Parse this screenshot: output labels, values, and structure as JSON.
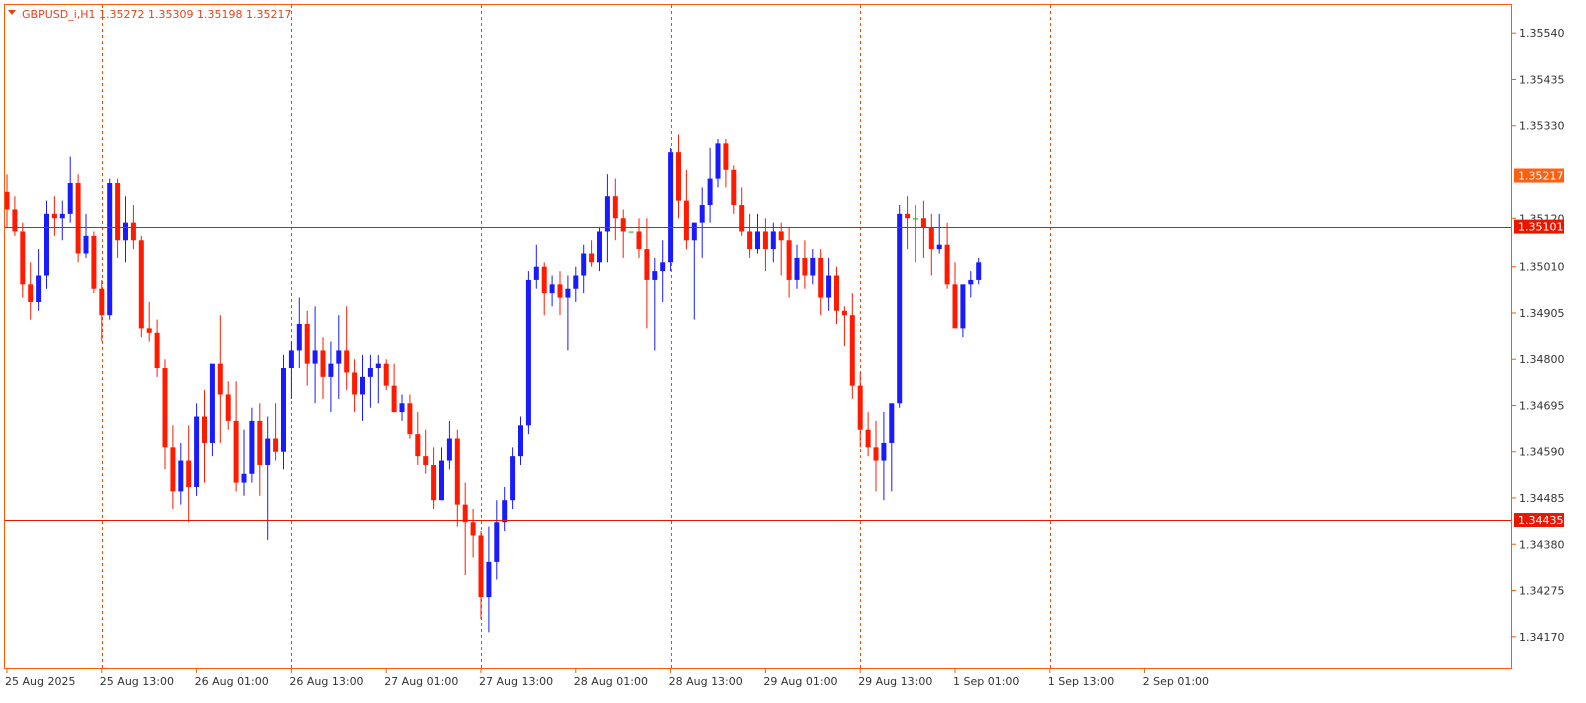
{
  "header": {
    "arrow_icon": "triangle-down-icon",
    "text": "GBPUSD_i,H1  1.35272 1.35309 1.35198 1.35217"
  },
  "colors": {
    "bull": "#1a1aff",
    "bear": "#ff1a00",
    "doji": "#22cc22",
    "grid": "#ff4400",
    "axis": "#ff5a00",
    "level_line": "#e81800",
    "bid_tag": "#ff6010"
  },
  "chart_data": {
    "type": "candlestick",
    "symbol": "GBPUSD_i",
    "timeframe": "H1",
    "ylim": [
      1.3414,
      1.3557
    ],
    "y_ticks": [
      "1.35540",
      "1.35435",
      "1.35330",
      "1.35120",
      "1.35010",
      "1.34905",
      "1.34800",
      "1.34695",
      "1.34590",
      "1.34485",
      "1.34380",
      "1.34275",
      "1.34170"
    ],
    "x_ticks": [
      "25 Aug 2025",
      "25 Aug 13:00",
      "26 Aug 01:00",
      "26 Aug 13:00",
      "27 Aug 01:00",
      "27 Aug 13:00",
      "28 Aug 01:00",
      "28 Aug 13:00",
      "29 Aug 01:00",
      "29 Aug 13:00",
      "1 Sep 01:00",
      "1 Sep 13:00",
      "2 Sep 01:00"
    ],
    "bars_per_label": 12,
    "day_separator_labels": [
      1,
      3,
      5,
      7,
      9,
      11
    ],
    "grid": "vertical dotted day separators",
    "horizontal_levels": [
      {
        "price": 1.35101,
        "label": "1.35101"
      },
      {
        "price": 1.34435,
        "label": "1.34435"
      }
    ],
    "bid": {
      "price": 1.35217,
      "label": "1.35217"
    },
    "candles": [
      [
        1.3518,
        1.3522,
        1.351,
        1.3514
      ],
      [
        1.3514,
        1.3517,
        1.3508,
        1.3509
      ],
      [
        1.3509,
        1.3511,
        1.3494,
        1.3497
      ],
      [
        1.3497,
        1.3502,
        1.3489,
        1.3493
      ],
      [
        1.3493,
        1.3505,
        1.3491,
        1.3499
      ],
      [
        1.3499,
        1.3516,
        1.3496,
        1.3513
      ],
      [
        1.3513,
        1.3517,
        1.3508,
        1.3512
      ],
      [
        1.3512,
        1.3516,
        1.3507,
        1.3513
      ],
      [
        1.3513,
        1.3526,
        1.3511,
        1.352
      ],
      [
        1.352,
        1.3522,
        1.3502,
        1.3504
      ],
      [
        1.3504,
        1.3513,
        1.3503,
        1.3508
      ],
      [
        1.3508,
        1.3509,
        1.3495,
        1.3496
      ],
      [
        1.3496,
        1.3498,
        1.3484,
        1.349
      ],
      [
        1.349,
        1.3521,
        1.3489,
        1.352
      ],
      [
        1.352,
        1.3521,
        1.3503,
        1.3507
      ],
      [
        1.3507,
        1.3517,
        1.3502,
        1.3511
      ],
      [
        1.3511,
        1.3515,
        1.3505,
        1.3507
      ],
      [
        1.3507,
        1.3508,
        1.3485,
        1.3487
      ],
      [
        1.3487,
        1.3493,
        1.3484,
        1.3486
      ],
      [
        1.3486,
        1.3489,
        1.3476,
        1.3478
      ],
      [
        1.3478,
        1.348,
        1.3455,
        1.346
      ],
      [
        1.346,
        1.3465,
        1.3446,
        1.345
      ],
      [
        1.345,
        1.3461,
        1.3447,
        1.3457
      ],
      [
        1.3457,
        1.3465,
        1.3443,
        1.3451
      ],
      [
        1.3451,
        1.347,
        1.3449,
        1.3467
      ],
      [
        1.3467,
        1.3473,
        1.3452,
        1.3461
      ],
      [
        1.3461,
        1.3477,
        1.3458,
        1.3479
      ],
      [
        1.3479,
        1.349,
        1.3461,
        1.3472
      ],
      [
        1.3472,
        1.3475,
        1.3464,
        1.3466
      ],
      [
        1.3466,
        1.3475,
        1.345,
        1.3452
      ],
      [
        1.3452,
        1.3464,
        1.3449,
        1.3454
      ],
      [
        1.3454,
        1.3469,
        1.3452,
        1.3466
      ],
      [
        1.3466,
        1.347,
        1.3449,
        1.3456
      ],
      [
        1.3456,
        1.3467,
        1.3439,
        1.3462
      ],
      [
        1.3462,
        1.347,
        1.3457,
        1.3459
      ],
      [
        1.3459,
        1.3481,
        1.3455,
        1.3478
      ],
      [
        1.3478,
        1.3484,
        1.3471,
        1.3482
      ],
      [
        1.3482,
        1.3494,
        1.3478,
        1.3488
      ],
      [
        1.3488,
        1.3491,
        1.3474,
        1.3479
      ],
      [
        1.3479,
        1.3492,
        1.347,
        1.3482
      ],
      [
        1.3482,
        1.3485,
        1.3471,
        1.3476
      ],
      [
        1.3476,
        1.3484,
        1.3468,
        1.3479
      ],
      [
        1.3479,
        1.349,
        1.3471,
        1.3482
      ],
      [
        1.3482,
        1.3492,
        1.3473,
        1.3477
      ],
      [
        1.3477,
        1.348,
        1.3468,
        1.3472
      ],
      [
        1.3472,
        1.3481,
        1.3466,
        1.3476
      ],
      [
        1.3476,
        1.3481,
        1.3469,
        1.3478
      ],
      [
        1.3478,
        1.3481,
        1.347,
        1.3479
      ],
      [
        1.3479,
        1.348,
        1.3473,
        1.3474
      ],
      [
        1.3474,
        1.3479,
        1.3468,
        1.3468
      ],
      [
        1.3468,
        1.3472,
        1.3466,
        1.347
      ],
      [
        1.347,
        1.3472,
        1.3462,
        1.3463
      ],
      [
        1.3463,
        1.3468,
        1.3456,
        1.3458
      ],
      [
        1.3458,
        1.3464,
        1.3454,
        1.3456
      ],
      [
        1.3456,
        1.346,
        1.3446,
        1.3448
      ],
      [
        1.3448,
        1.346,
        1.3448,
        1.3457
      ],
      [
        1.3457,
        1.3466,
        1.3455,
        1.3462
      ],
      [
        1.3462,
        1.3464,
        1.3442,
        1.3447
      ],
      [
        1.3447,
        1.3452,
        1.3431,
        1.3443
      ],
      [
        1.3443,
        1.3446,
        1.3435,
        1.344
      ],
      [
        1.344,
        1.3441,
        1.3421,
        1.3426
      ],
      [
        1.3426,
        1.3442,
        1.3418,
        1.3434
      ],
      [
        1.3434,
        1.3448,
        1.343,
        1.3443
      ],
      [
        1.3443,
        1.3451,
        1.3441,
        1.3448
      ],
      [
        1.3448,
        1.346,
        1.3446,
        1.3458
      ],
      [
        1.3458,
        1.3467,
        1.3456,
        1.3465
      ],
      [
        1.3465,
        1.35,
        1.3463,
        1.3498
      ],
      [
        1.3498,
        1.3506,
        1.3496,
        1.3501
      ],
      [
        1.3501,
        1.3502,
        1.349,
        1.3495
      ],
      [
        1.3495,
        1.3499,
        1.3492,
        1.3497
      ],
      [
        1.3497,
        1.35,
        1.349,
        1.3494
      ],
      [
        1.3494,
        1.3499,
        1.3482,
        1.3496
      ],
      [
        1.3496,
        1.3501,
        1.3493,
        1.3499
      ],
      [
        1.3499,
        1.3506,
        1.3495,
        1.3504
      ],
      [
        1.3504,
        1.3507,
        1.3501,
        1.3502
      ],
      [
        1.3502,
        1.351,
        1.35,
        1.3509
      ],
      [
        1.3509,
        1.3522,
        1.3502,
        1.3517
      ],
      [
        1.3517,
        1.3521,
        1.3507,
        1.3512
      ],
      [
        1.3512,
        1.3514,
        1.3503,
        1.3509
      ],
      [
        1.3509,
        1.3506,
        1.3506,
        1.3509
      ],
      [
        1.3509,
        1.3512,
        1.3503,
        1.3505
      ],
      [
        1.3505,
        1.3512,
        1.3487,
        1.3498
      ],
      [
        1.3498,
        1.3503,
        1.3482,
        1.35
      ],
      [
        1.35,
        1.3507,
        1.3493,
        1.3502
      ],
      [
        1.3502,
        1.3528,
        1.35,
        1.3527
      ],
      [
        1.3527,
        1.3531,
        1.3512,
        1.3516
      ],
      [
        1.3516,
        1.3523,
        1.3505,
        1.3507
      ],
      [
        1.3507,
        1.3511,
        1.3489,
        1.3511
      ],
      [
        1.3511,
        1.3519,
        1.3503,
        1.3515
      ],
      [
        1.3515,
        1.3528,
        1.3511,
        1.3521
      ],
      [
        1.3521,
        1.353,
        1.3519,
        1.3529
      ],
      [
        1.3529,
        1.353,
        1.3519,
        1.3523
      ],
      [
        1.3523,
        1.3524,
        1.3513,
        1.3515
      ],
      [
        1.3515,
        1.3519,
        1.3508,
        1.3509
      ],
      [
        1.3509,
        1.3513,
        1.3503,
        1.3505
      ],
      [
        1.3505,
        1.3513,
        1.3504,
        1.3509
      ],
      [
        1.3509,
        1.3512,
        1.35,
        1.3505
      ],
      [
        1.3505,
        1.3511,
        1.3502,
        1.3509
      ],
      [
        1.3509,
        1.3511,
        1.3499,
        1.3507
      ],
      [
        1.3507,
        1.351,
        1.3494,
        1.3498
      ],
      [
        1.3498,
        1.3506,
        1.3496,
        1.3503
      ],
      [
        1.3503,
        1.3507,
        1.3496,
        1.3499
      ],
      [
        1.3499,
        1.3505,
        1.3497,
        1.3503
      ],
      [
        1.3503,
        1.3505,
        1.349,
        1.3494
      ],
      [
        1.3494,
        1.3503,
        1.3491,
        1.3499
      ],
      [
        1.3499,
        1.3501,
        1.3488,
        1.3491
      ],
      [
        1.3491,
        1.3492,
        1.3483,
        1.349
      ],
      [
        1.349,
        1.3495,
        1.3471,
        1.3474
      ],
      [
        1.3474,
        1.3477,
        1.346,
        1.3464
      ],
      [
        1.3464,
        1.3468,
        1.3458,
        1.346
      ],
      [
        1.346,
        1.3466,
        1.345,
        1.3457
      ],
      [
        1.3457,
        1.3468,
        1.3448,
        1.3461
      ],
      [
        1.3461,
        1.347,
        1.345,
        1.347
      ],
      [
        1.347,
        1.3515,
        1.3469,
        1.3513
      ],
      [
        1.3513,
        1.3517,
        1.3505,
        1.3512
      ],
      [
        1.3512,
        1.3515,
        1.3502,
        1.3512
      ],
      [
        1.3512,
        1.3516,
        1.3503,
        1.351
      ],
      [
        1.351,
        1.3513,
        1.3499,
        1.3505
      ],
      [
        1.3505,
        1.3513,
        1.3504,
        1.3506
      ],
      [
        1.3506,
        1.3511,
        1.3496,
        1.3497
      ],
      [
        1.3497,
        1.3502,
        1.3488,
        1.3487
      ],
      [
        1.3487,
        1.3496,
        1.3485,
        1.3497
      ],
      [
        1.3497,
        1.35,
        1.3494,
        1.3498
      ],
      [
        1.3498,
        1.3503,
        1.3497,
        1.3502
      ]
    ]
  }
}
